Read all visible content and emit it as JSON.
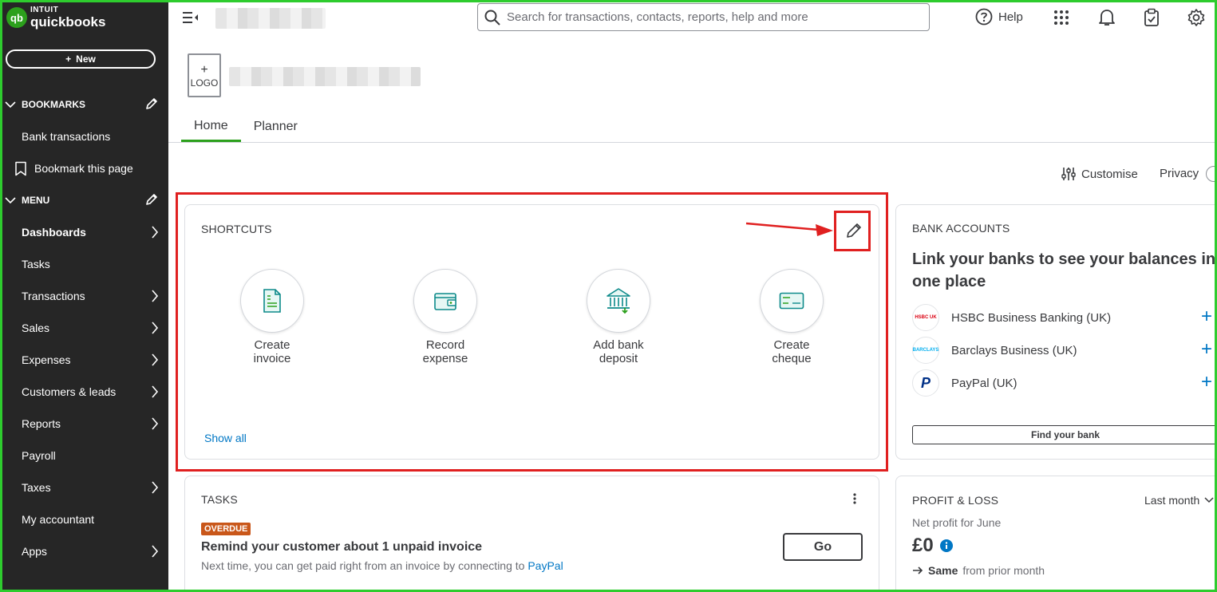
{
  "brand": {
    "small": "INTUIT",
    "big": "quickbooks",
    "badge": "qb"
  },
  "sidebar": {
    "new_label": "New",
    "bookmarks_label": "BOOKMARKS",
    "bookmarks": [
      {
        "label": "Bank transactions"
      },
      {
        "label": "Bookmark this page"
      }
    ],
    "menu_label": "MENU",
    "menu": [
      {
        "label": "Dashboards"
      },
      {
        "label": "Tasks"
      },
      {
        "label": "Transactions"
      },
      {
        "label": "Sales"
      },
      {
        "label": "Expenses"
      },
      {
        "label": "Customers & leads"
      },
      {
        "label": "Reports"
      },
      {
        "label": "Payroll"
      },
      {
        "label": "Taxes"
      },
      {
        "label": "My accountant"
      },
      {
        "label": "Apps"
      }
    ]
  },
  "search": {
    "placeholder": "Search for transactions, contacts, reports, help and more"
  },
  "header": {
    "help_label": "Help",
    "logo_plus": "+",
    "logo_label": "LOGO"
  },
  "tabs": [
    {
      "label": "Home"
    },
    {
      "label": "Planner"
    }
  ],
  "toolbar": {
    "customise_label": "Customise",
    "privacy_label": "Privacy"
  },
  "shortcuts": {
    "title": "SHORTCUTS",
    "items": [
      {
        "line1": "Create",
        "line2": "invoice"
      },
      {
        "line1": "Record",
        "line2": "expense"
      },
      {
        "line1": "Add bank",
        "line2": "deposit"
      },
      {
        "line1": "Create",
        "line2": "cheque"
      }
    ],
    "show_all": "Show all"
  },
  "bank_accounts": {
    "title": "BANK ACCOUNTS",
    "headline": "Link your banks to see your balances in one place",
    "banks": [
      {
        "name": "HSBC Business Banking (UK)",
        "logo_text": "HSBC UK"
      },
      {
        "name": "Barclays Business (UK)",
        "logo_text": "BARCLAYS"
      },
      {
        "name": "PayPal (UK)",
        "logo_text": "P"
      }
    ],
    "find_bank": "Find your bank"
  },
  "tasks": {
    "title": "TASKS",
    "badge": "OVERDUE",
    "item_title": "Remind your customer about 1 unpaid invoice",
    "item_desc": "Next time, you can get paid right from an invoice by connecting to",
    "item_link": "PayPal",
    "go_label": "Go"
  },
  "profit_loss": {
    "title": "PROFIT & LOSS",
    "period": "Last month",
    "subtitle": "Net profit for June",
    "amount": "£0",
    "comparison_bold": "Same",
    "comparison_rest": "from prior month"
  },
  "colors": {
    "sidebar_bg": "#262626",
    "brand_green": "#2ca01c",
    "link_blue": "#0077c5",
    "overdue": "#c9571a",
    "annotation_red": "#e02020",
    "frame_green": "#2ecc2e"
  }
}
